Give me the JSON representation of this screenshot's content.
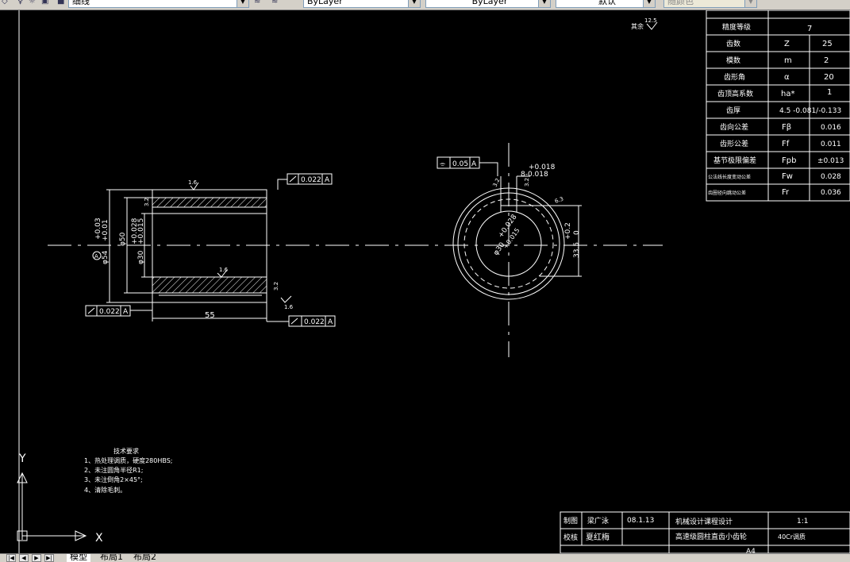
{
  "toolbar": {
    "linetype_combo": "细线",
    "color_combo": "ByLayer",
    "linetype_combo2": "ByLayer",
    "lineweight_combo": "默认",
    "plotstyle_combo": "随颜色"
  },
  "drawing": {
    "surface_finish_rest": "其余",
    "surface_finish_rest_value": "12.5",
    "left_view": {
      "roughness_top": "1.6",
      "roughness_3_2_a": "3.2",
      "roughness_bore": "1.6",
      "roughness_right": "3.2",
      "roughness_bottom": "1.6",
      "dim_outer_tol": "+0.03",
      "dim_outer_tol2": "+0.01",
      "dim_outer": "φ54",
      "dim_50": "φ50",
      "dim_bore_tol": "+0.028",
      "dim_bore_tol2": "+0.015",
      "dim_bore": "φ30",
      "dim_length": "55",
      "datum_a": "A",
      "gtol_top_value": "0.022",
      "gtol_top_datum": "A",
      "gtol_left_value": "0.022",
      "gtol_left_datum": "A",
      "gtol_bottom_value": "0.022",
      "gtol_bottom_datum": "A"
    },
    "right_view": {
      "gtol_value": "0.05",
      "gtol_datum": "A",
      "key_tol_upper": "+0.018",
      "key_tol_lower": "8-0.018",
      "roughness_key": "3.2",
      "roughness_key2": "3.2",
      "roughness_outer": "6.3",
      "dim_bore_tol": "+0.028",
      "dim_bore_tol2": "+0.015",
      "dim_bore": "φ30",
      "dim_keyway_tol": "+0.2",
      "dim_keyway_tol2": "0",
      "dim_keyway": "33.5"
    },
    "tech_requirements": {
      "title": "技术要求",
      "items": [
        "1、热处理调质，硬度280HBS;",
        "2、未注圆角半径R1;",
        "3、未注倒角2×45°;",
        "4、清除毛刺。"
      ]
    },
    "ucs": {
      "y": "Y",
      "x": "X"
    },
    "param_table": [
      {
        "name": "精度等级",
        "symbol": "",
        "value": "7"
      },
      {
        "name": "齿数",
        "symbol": "Z",
        "value": "25"
      },
      {
        "name": "模数",
        "symbol": "m",
        "value": "2"
      },
      {
        "name": "齿形角",
        "symbol": "α",
        "value": "20"
      },
      {
        "name": "齿顶高系数",
        "symbol": "ha*",
        "value": "1"
      },
      {
        "name": "齿厚",
        "symbol": "4.5 -0.081/-0.133",
        "value": ""
      },
      {
        "name": "齿向公差",
        "symbol": "Fβ",
        "value": "0.016"
      },
      {
        "name": "齿形公差",
        "symbol": "Ff",
        "value": "0.011"
      },
      {
        "name": "基节极限偏差",
        "symbol": "Fpb",
        "value": "±0.013"
      },
      {
        "name": "公法线长度变动公差",
        "symbol": "Fw",
        "value": "0.028"
      },
      {
        "name": "齿圈径向跳动公差",
        "symbol": "Fr",
        "value": "0.036"
      }
    ],
    "title_block": {
      "drawn_label": "制图",
      "drawn_name": "梁广泳",
      "drawn_date": "08.1.13",
      "checked_label": "校核",
      "checked_name": "夏红梅",
      "course": "机械设计课程设计",
      "scale": "1:1",
      "part_name": "高速级圆柱直齿小齿轮",
      "material": "40Cr调质",
      "sheet": "A4"
    }
  },
  "tabs": [
    "模型",
    "布局1",
    "布局2"
  ]
}
